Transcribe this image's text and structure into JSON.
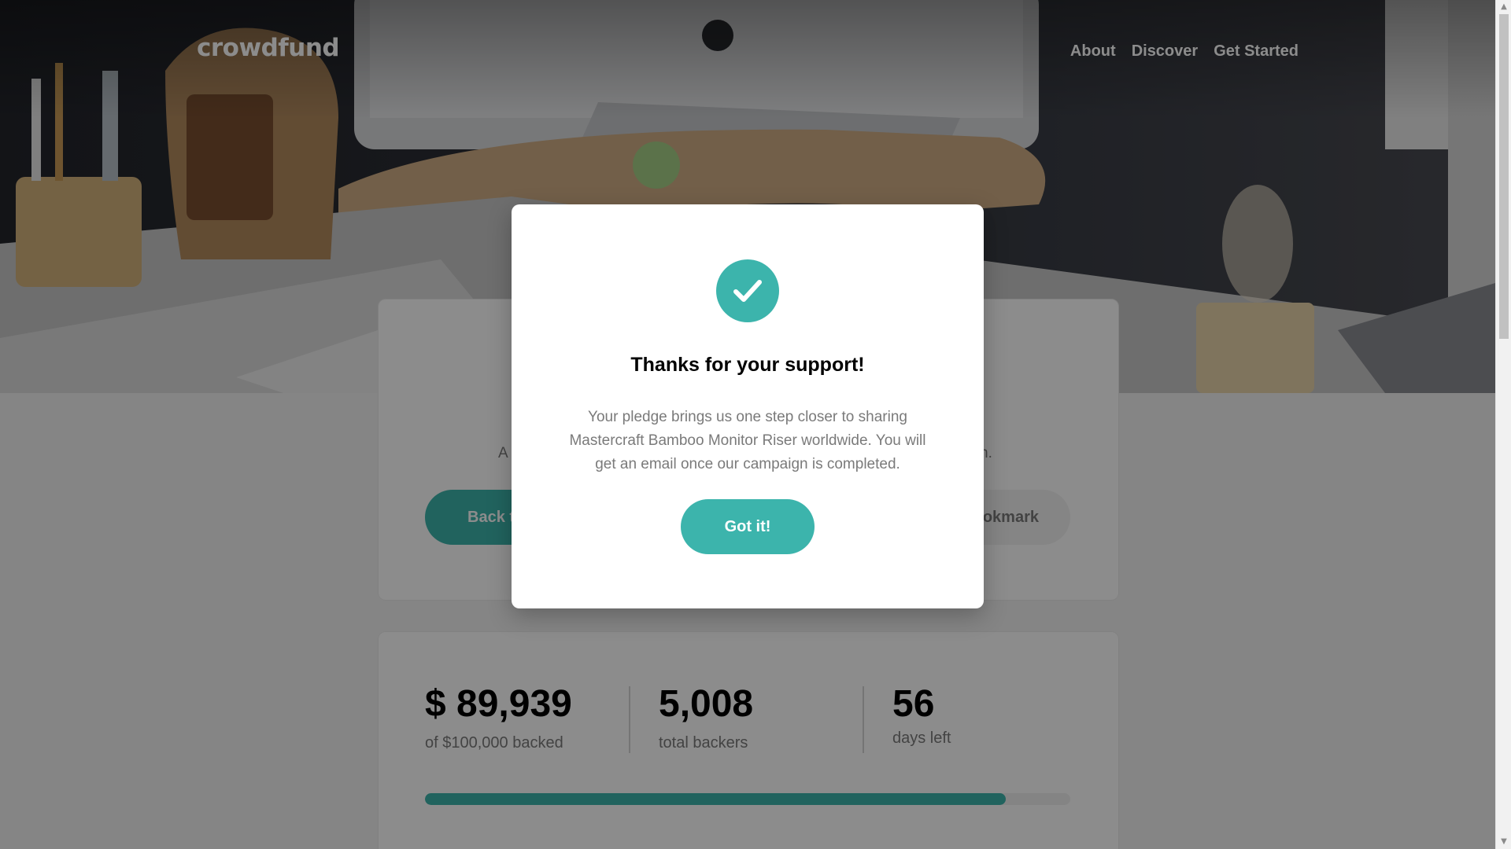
{
  "header": {
    "logo": "crowdfund",
    "nav": [
      "About",
      "Discover",
      "Get Started"
    ]
  },
  "intro": {
    "description_fragment_left": "A",
    "description_fragment_right": "n.",
    "back_button_visible": "Back t",
    "bookmark_button_visible": "ookmark"
  },
  "stats": {
    "backed_value": "$ 89,939",
    "backed_label": "of $100,000 backed",
    "backers_value": "5,008",
    "backers_label": "total backers",
    "days_value": "56",
    "days_label": "days left",
    "progress_fraction": 0.8994
  },
  "modal": {
    "title": "Thanks for your support!",
    "text": "Your pledge brings us one step closer to sharing Mastercraft Bamboo Monitor Riser worldwide. You will get an email once our campaign is completed.",
    "button": "Got it!"
  },
  "colors": {
    "accent": "#3cb4ac",
    "accent_dark": "#147b74"
  },
  "icons": {
    "modal_icon": "check-icon",
    "scroll_up": "scroll-up-icon",
    "scroll_down": "scroll-down-icon"
  }
}
